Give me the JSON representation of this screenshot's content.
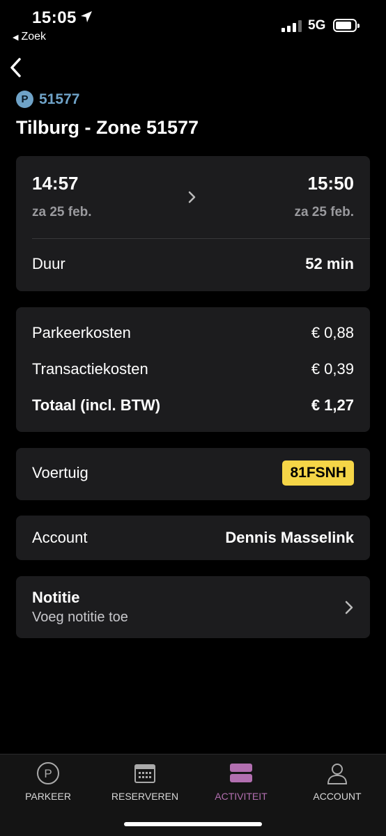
{
  "status_bar": {
    "time": "15:05",
    "back_app": "Zoek",
    "network": "5G"
  },
  "header": {
    "zone_badge": "P",
    "zone_number": "51577",
    "title": "Tilburg - Zone 51577"
  },
  "session": {
    "start_time": "14:57",
    "start_date": "za 25 feb.",
    "end_time": "15:50",
    "end_date": "za 25 feb.",
    "duration_label": "Duur",
    "duration_value": "52 min"
  },
  "costs": {
    "parking_label": "Parkeerkosten",
    "parking_value": "€ 0,88",
    "transaction_label": "Transactiekosten",
    "transaction_value": "€ 0,39",
    "total_label": "Totaal (incl. BTW)",
    "total_value": "€ 1,27"
  },
  "vehicle": {
    "label": "Voertuig",
    "plate": "81FSNH"
  },
  "account": {
    "label": "Account",
    "name": "Dennis Masselink"
  },
  "note": {
    "title": "Notitie",
    "subtitle": "Voeg notitie toe"
  },
  "tabbar": {
    "items": [
      {
        "label": "PARKEER",
        "icon": "parking-circle-icon"
      },
      {
        "label": "RESERVEREN",
        "icon": "calendar-icon"
      },
      {
        "label": "ACTIVITEIT",
        "icon": "activity-stack-icon",
        "active": true
      },
      {
        "label": "ACCOUNT",
        "icon": "person-icon"
      }
    ]
  },
  "colors": {
    "background": "#000000",
    "card": "#1c1c1e",
    "zone_accent": "#6fa3c8",
    "plate_yellow": "#f5d547",
    "active_tab": "#b26fb0"
  }
}
